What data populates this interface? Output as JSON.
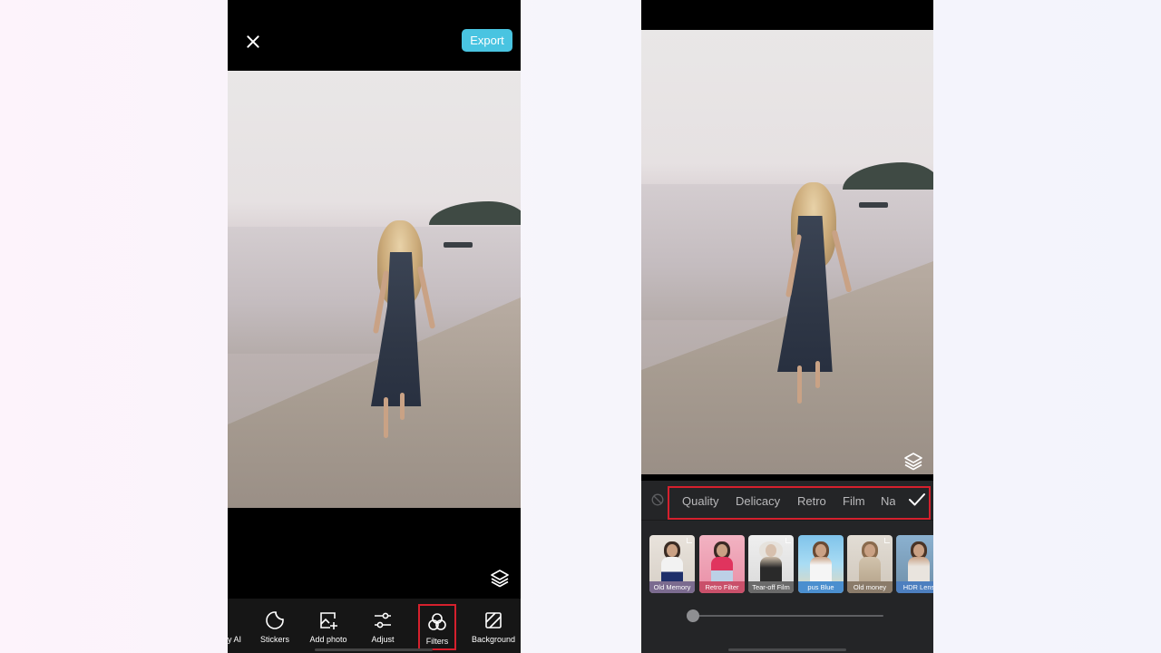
{
  "left_screen": {
    "close_icon": "close-icon",
    "export_label": "Export",
    "layers_icon": "layers-icon",
    "toolbar": [
      {
        "id": "ai",
        "label": "y AI",
        "icon": "ai-icon",
        "selected": false
      },
      {
        "id": "stickers",
        "label": "Stickers",
        "icon": "sticker-icon",
        "selected": false
      },
      {
        "id": "add-photo",
        "label": "Add photo",
        "icon": "add-photo-icon",
        "selected": false
      },
      {
        "id": "adjust",
        "label": "Adjust",
        "icon": "sliders-icon",
        "selected": false
      },
      {
        "id": "filters",
        "label": "Filters",
        "icon": "filters-icon",
        "selected": true
      },
      {
        "id": "background",
        "label": "Background",
        "icon": "background-icon",
        "selected": false
      }
    ]
  },
  "right_screen": {
    "layers_icon": "layers-icon",
    "categories": [
      {
        "label": "Quality"
      },
      {
        "label": "Delicacy"
      },
      {
        "label": "Retro"
      },
      {
        "label": "Film"
      },
      {
        "label": "Na"
      }
    ],
    "filters": [
      {
        "label": "Old Memory",
        "label_color": "#7b6b8f"
      },
      {
        "label": "Retro Filter",
        "label_color": "#c9506a"
      },
      {
        "label": "Tear-off Film",
        "label_color": "#6a6a6a"
      },
      {
        "label": "pus Blue",
        "label_color": "#4b8fcf"
      },
      {
        "label": "Old money",
        "label_color": "#8a7b6a"
      },
      {
        "label": "HDR Lens",
        "label_color": "#4d7fbf"
      }
    ],
    "intensity": 0.0
  },
  "colors": {
    "accent": "#49c4e1",
    "highlight": "#d5202d",
    "panel": "#242527",
    "toolbar": "#161616"
  }
}
